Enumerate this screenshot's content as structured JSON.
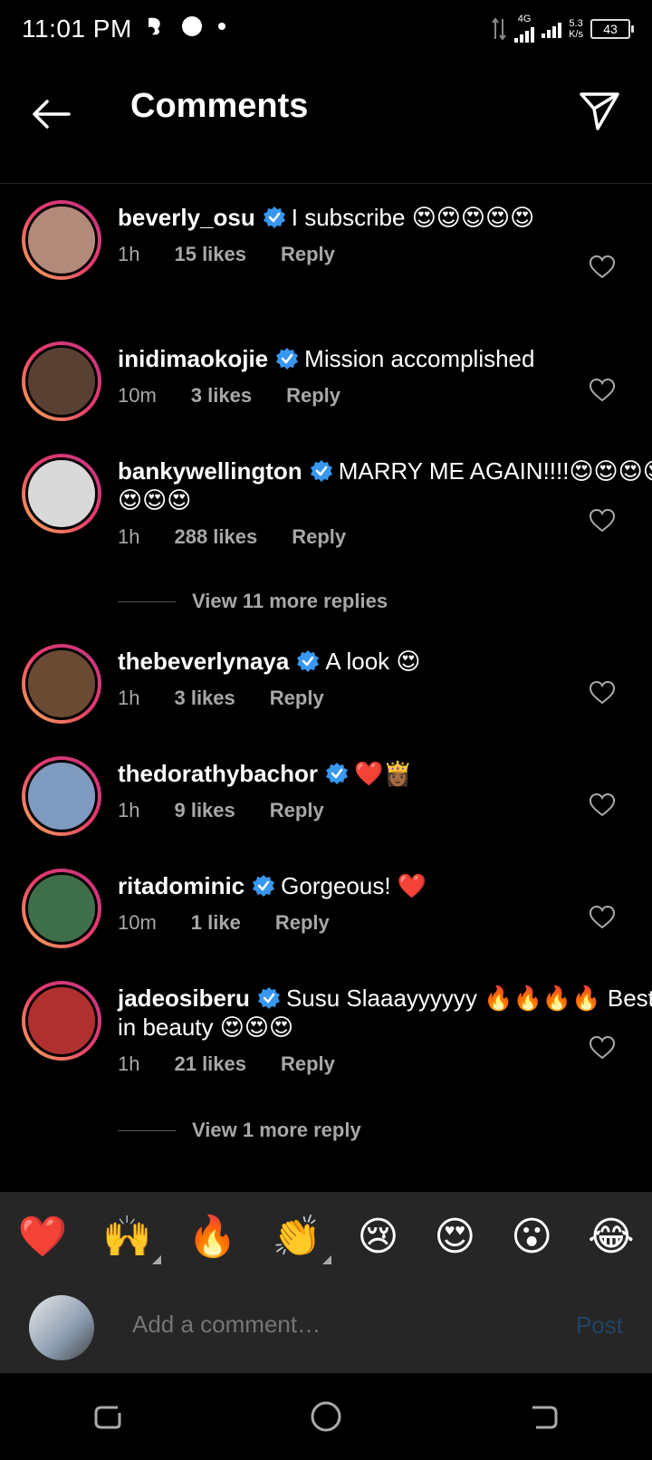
{
  "status": {
    "time": "11:01 PM",
    "network": "4G",
    "speed_value": "5.3",
    "speed_unit": "K/s",
    "battery": "43"
  },
  "header": {
    "title": "Comments"
  },
  "comments": [
    {
      "username": "beverly_osu",
      "text": "I subscribe 😍😍😍😍😍",
      "time": "1h",
      "likes": "15 likes",
      "reply": "Reply",
      "avatar_color": "#b38a7a"
    },
    {
      "username": "inidimaokojie",
      "text": "Mission accomplished",
      "time": "10m",
      "likes": "3 likes",
      "reply": "Reply",
      "avatar_color": "#5a4032"
    },
    {
      "username": "bankywellington",
      "text": "MARRY ME AGAIN!!!!😍😍😍😍😍😍😍",
      "time": "1h",
      "likes": "288 likes",
      "reply": "Reply",
      "avatar_color": "#d9d9d9"
    },
    {
      "username": "thebeverlynaya",
      "text": "A look 😍",
      "time": "1h",
      "likes": "3 likes",
      "reply": "Reply",
      "avatar_color": "#6b4a33"
    },
    {
      "username": "thedorathybachor",
      "text": "❤️👸🏾",
      "time": "1h",
      "likes": "9 likes",
      "reply": "Reply",
      "avatar_color": "#7f9bbf"
    },
    {
      "username": "ritadominic",
      "text": "Gorgeous! ❤️",
      "time": "10m",
      "likes": "1 like",
      "reply": "Reply",
      "avatar_color": "#3f6f4a"
    },
    {
      "username": "jadeosiberu",
      "text": "Susu Slaaayyyyyy 🔥🔥🔥🔥 Best in beauty 😍😍😍",
      "time": "1h",
      "likes": "21 likes",
      "reply": "Reply",
      "avatar_color": "#b03030"
    }
  ],
  "view_more": [
    "View 11 more replies",
    "View 1 more reply"
  ],
  "emoji_bar": [
    "❤️",
    "🙌",
    "🔥",
    "👏",
    "😢",
    "😍",
    "😮",
    "😂"
  ],
  "input": {
    "placeholder": "Add a comment…",
    "post_label": "Post"
  },
  "colors": {
    "verified": "#3897f0",
    "muted": "#a8a8a8",
    "post_disabled": "#224466"
  }
}
